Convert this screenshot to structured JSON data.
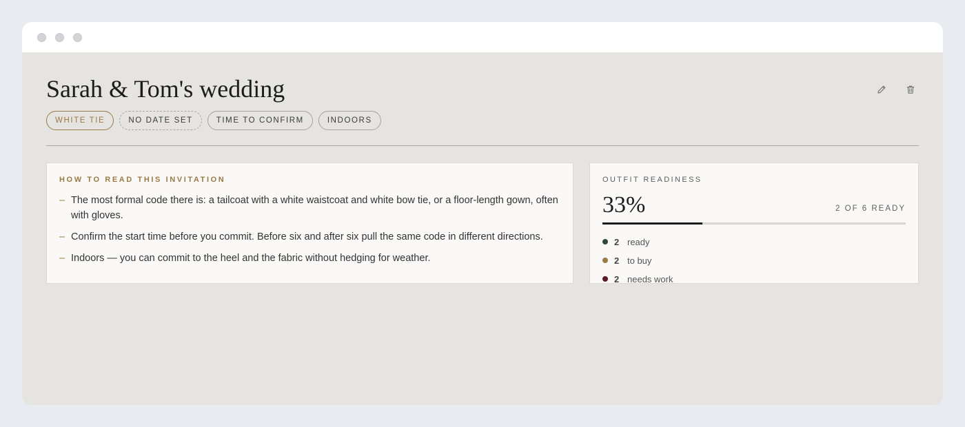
{
  "header": {
    "title": "Sarah & Tom's wedding",
    "edit_icon": "pencil-icon",
    "delete_icon": "trash-icon"
  },
  "tags": [
    {
      "label": "WHITE TIE",
      "style": "primary"
    },
    {
      "label": "NO DATE SET",
      "style": "dashed"
    },
    {
      "label": "TIME TO CONFIRM",
      "style": "default"
    },
    {
      "label": "INDOORS",
      "style": "default"
    }
  ],
  "guidance": {
    "heading": "HOW TO READ THIS INVITATION",
    "items": [
      "The most formal code there is: a tailcoat with a white waistcoat and white bow tie, or a floor-length gown, often with gloves.",
      "Confirm the start time before you commit. Before six and after six pull the same code in different directions.",
      "Indoors — you can commit to the heel and the fabric without hedging for weather."
    ]
  },
  "readiness": {
    "heading": "OUTFIT READINESS",
    "percent": "33%",
    "progress_fraction": 0.33,
    "summary": "2 OF 6 READY",
    "legend": [
      {
        "count": "2",
        "label": "ready",
        "color": "#2f4a3c"
      },
      {
        "count": "2",
        "label": "to buy",
        "color": "#9a7a45"
      },
      {
        "count": "2",
        "label": "needs work",
        "color": "#5c1a24"
      }
    ]
  },
  "colors": {
    "accent": "#9a7a45",
    "background": "#e6e4e0",
    "panel": "#faf9f7"
  }
}
